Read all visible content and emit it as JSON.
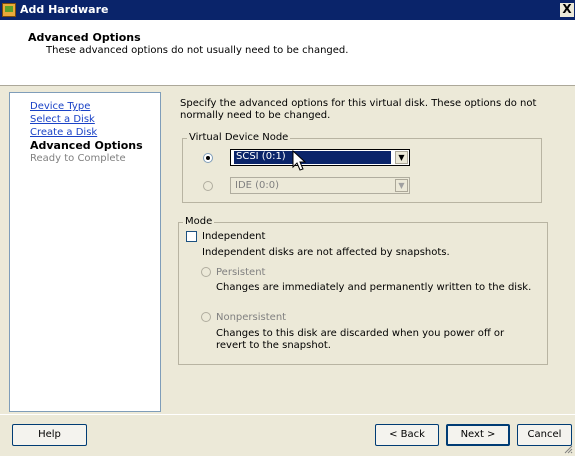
{
  "window": {
    "title": "Add Hardware",
    "close_glyph": "X"
  },
  "header": {
    "title": "Advanced Options",
    "subtitle": "These advanced options do not usually need to be changed."
  },
  "sidebar": {
    "steps": [
      {
        "label": "Device Type",
        "state": "link"
      },
      {
        "label": "Select a Disk",
        "state": "link"
      },
      {
        "label": "Create a Disk",
        "state": "link"
      },
      {
        "label": "Advanced Options",
        "state": "current"
      },
      {
        "label": "Ready to Complete",
        "state": "future"
      }
    ]
  },
  "content": {
    "description": "Specify the advanced options for this virtual disk. These options do not normally need to be changed.",
    "virtual_device_node": {
      "label": "Virtual Device Node",
      "scsi_value": "SCSI (0:1)",
      "ide_value": "IDE (0:0)",
      "scsi_selected": true
    },
    "mode": {
      "label": "Mode",
      "independent_label": "Independent",
      "independent_checked": false,
      "independent_note": "Independent disks are not affected by snapshots.",
      "persistent_label": "Persistent",
      "persistent_note": "Changes are immediately and permanently written to the disk.",
      "nonpersistent_label": "Nonpersistent",
      "nonpersistent_note": "Changes to this disk are discarded when you power off or revert to the snapshot."
    }
  },
  "footer": {
    "help_label": "Help",
    "back_label": "< Back",
    "next_label": "Next >",
    "cancel_label": "Cancel"
  },
  "icons": {
    "app": "add-hardware-icon",
    "combo_arrow": "chevron-down-icon",
    "cursor": "mouse-pointer-icon"
  }
}
